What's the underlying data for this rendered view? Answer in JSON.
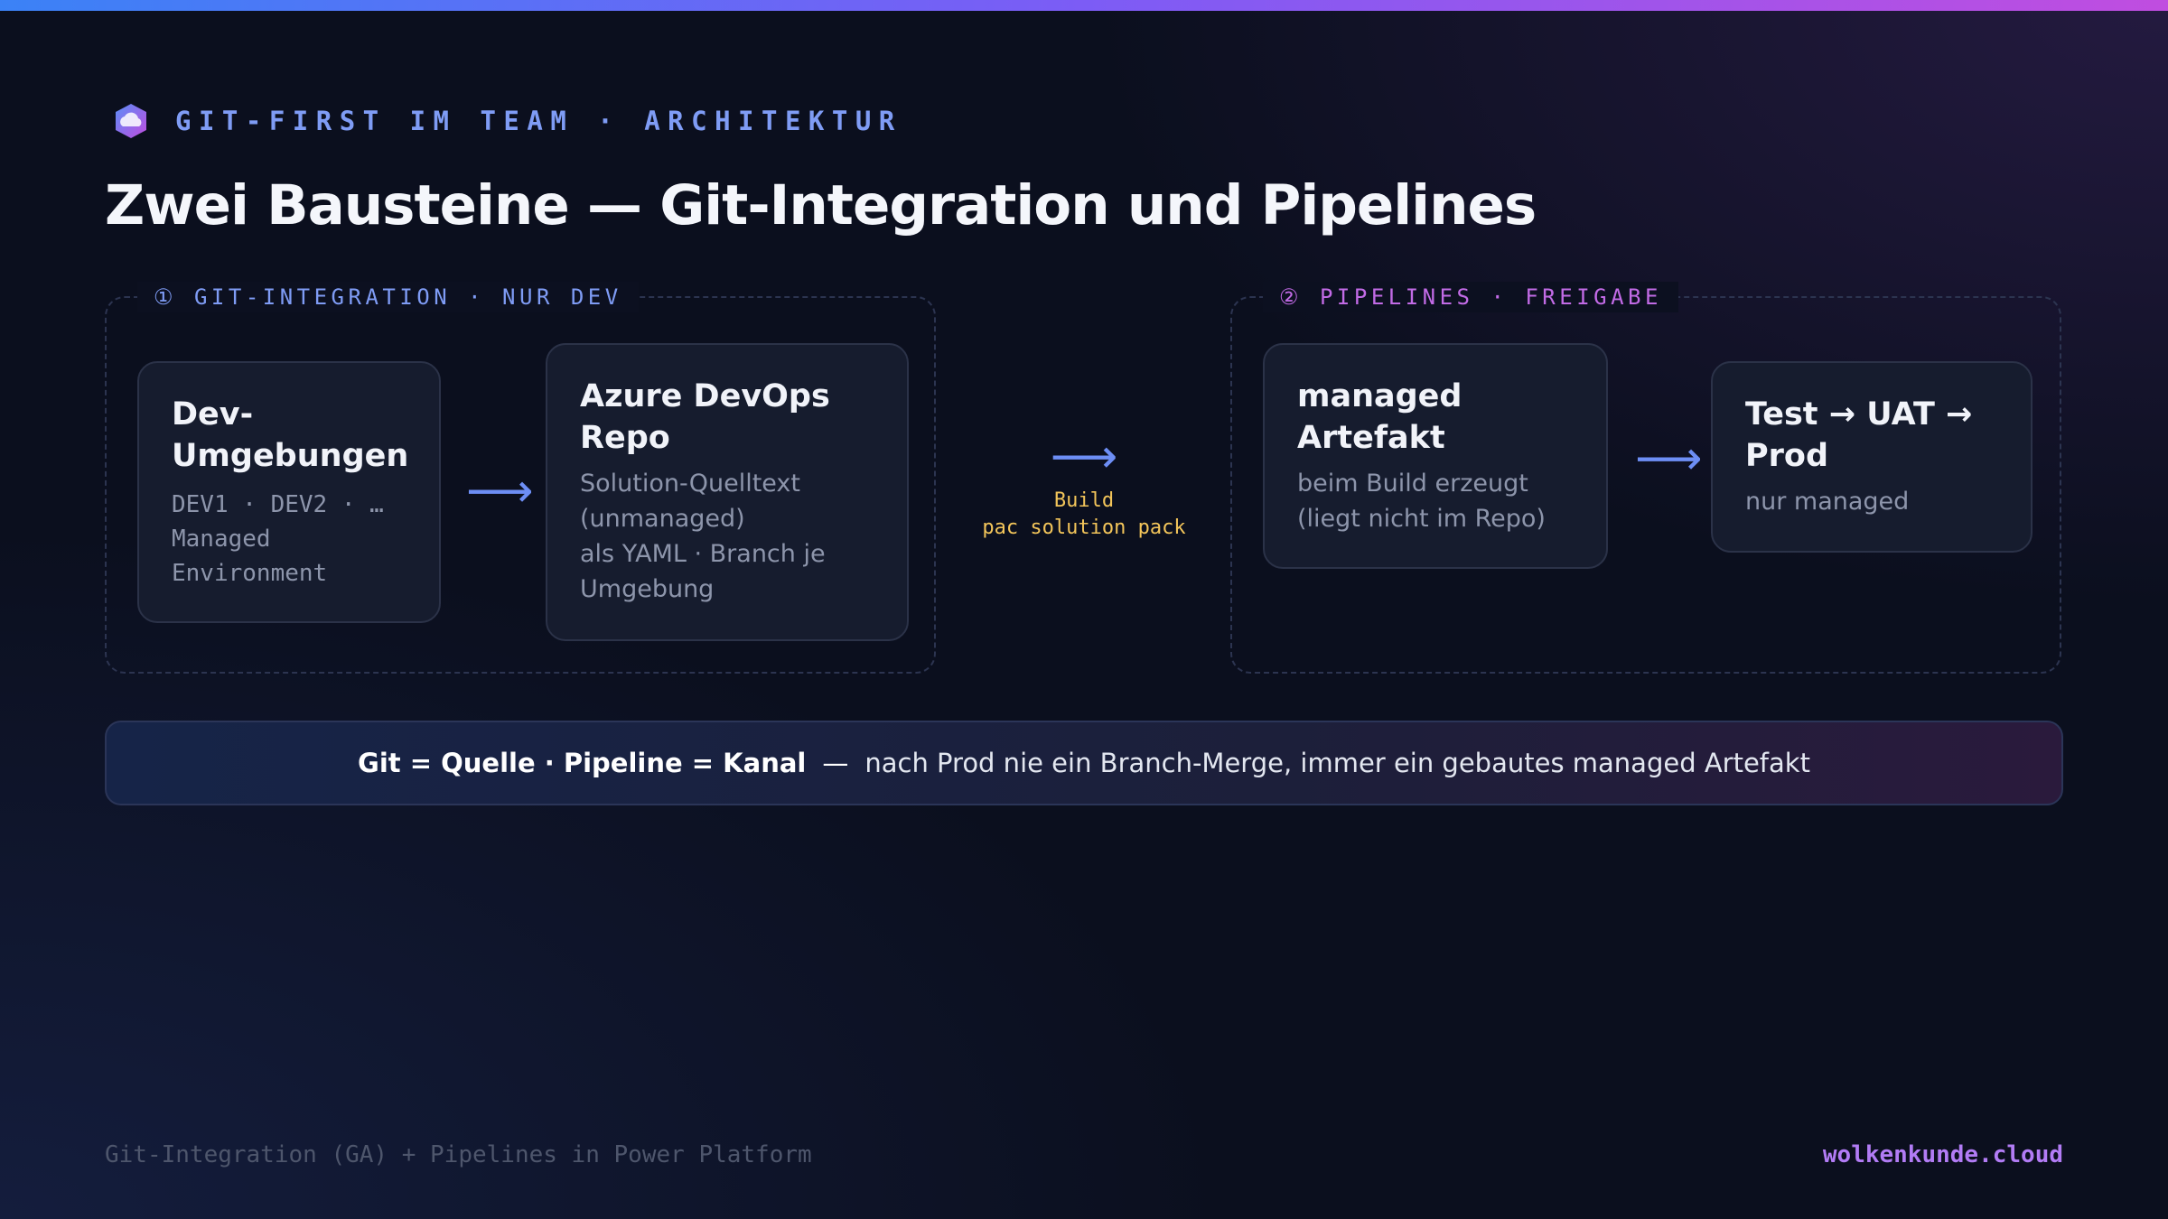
{
  "header": {
    "eyebrow": "GIT-FIRST IM TEAM · ARCHITEKTUR",
    "title": "Zwei Bausteine — Git-Integration und Pipelines"
  },
  "groups": [
    {
      "label": "① GIT-INTEGRATION · NUR DEV",
      "cards": [
        {
          "title": [
            "Dev-",
            "Umgebungen"
          ],
          "sub": [
            "DEV1 · DEV2 · …",
            "Managed",
            "Environment"
          ]
        },
        {
          "title": [
            "Azure DevOps",
            "Repo"
          ],
          "sub": [
            "Solution-Quelltext",
            "(unmanaged)",
            "als YAML · Branch je",
            "Umgebung"
          ]
        }
      ]
    },
    {
      "label": "② PIPELINES · FREIGABE",
      "cards": [
        {
          "title": [
            "managed",
            "Artefakt"
          ],
          "sub": [
            "beim Build erzeugt",
            "(liegt nicht im Repo)"
          ]
        },
        {
          "title": [
            "Test → UAT →",
            "Prod"
          ],
          "sub": [
            "nur managed"
          ]
        }
      ]
    }
  ],
  "connector": {
    "arrow": "⟶",
    "line1": "Build",
    "line2": "pac solution pack"
  },
  "banner": {
    "strong": "Git = Quelle · Pipeline = Kanal",
    "separator": "—",
    "rest": "nach Prod nie ein Branch-Merge, immer ein gebautes managed Artefakt"
  },
  "footer": {
    "left": "Git-Integration (GA) + Pipelines in Power Platform",
    "right": "wolkenkunde.cloud"
  },
  "colors": {
    "accent_blue": "#7f9cf5",
    "accent_purple": "#c26be6",
    "build_yellow": "#f3c55a",
    "brand": "#b27cf5"
  },
  "icons": {
    "logo": "cloud-logo-icon",
    "arrow": "arrow-right-icon"
  }
}
